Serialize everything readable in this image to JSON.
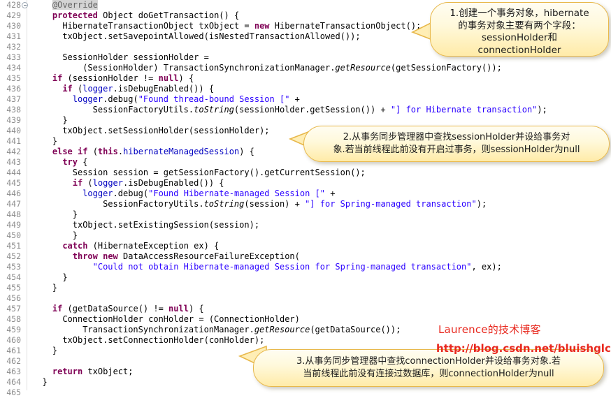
{
  "editor": {
    "first_line_number": 428,
    "fold_marker_line": 428,
    "lines": [
      {
        "n": "428",
        "fold": true,
        "indent": 4,
        "tokens": [
          {
            "t": "@Override",
            "c": "ann hl"
          }
        ]
      },
      {
        "n": "429",
        "fold": false,
        "indent": 4,
        "tokens": [
          {
            "t": "protected",
            "c": "kw"
          },
          {
            "t": " Object doGetTransaction() {",
            "c": ""
          }
        ]
      },
      {
        "n": "430",
        "fold": false,
        "indent": 6,
        "tokens": [
          {
            "t": "HibernateTransactionObject txObject = ",
            "c": ""
          },
          {
            "t": "new",
            "c": "kw"
          },
          {
            "t": " HibernateTransactionObject();",
            "c": ""
          }
        ]
      },
      {
        "n": "431",
        "fold": false,
        "indent": 6,
        "tokens": [
          {
            "t": "txObject.setSavepointAllowed(isNestedTransactionAllowed());",
            "c": ""
          }
        ]
      },
      {
        "n": "432",
        "fold": false,
        "indent": 0,
        "tokens": [
          {
            "t": "",
            "c": ""
          }
        ]
      },
      {
        "n": "433",
        "fold": false,
        "indent": 6,
        "tokens": [
          {
            "t": "SessionHolder sessionHolder =",
            "c": ""
          }
        ]
      },
      {
        "n": "434",
        "fold": false,
        "indent": 10,
        "tokens": [
          {
            "t": "(SessionHolder) TransactionSynchronizationManager.",
            "c": ""
          },
          {
            "t": "getResource",
            "c": "mth"
          },
          {
            "t": "(getSessionFactory());",
            "c": ""
          }
        ]
      },
      {
        "n": "435",
        "fold": false,
        "indent": 4,
        "tokens": [
          {
            "t": "if",
            "c": "kw"
          },
          {
            "t": " (sessionHolder != ",
            "c": ""
          },
          {
            "t": "null",
            "c": "kw"
          },
          {
            "t": ") {",
            "c": ""
          }
        ]
      },
      {
        "n": "436",
        "fold": false,
        "indent": 6,
        "tokens": [
          {
            "t": "if",
            "c": "kw"
          },
          {
            "t": " (",
            "c": ""
          },
          {
            "t": "logger",
            "c": "fld"
          },
          {
            "t": ".isDebugEnabled()) {",
            "c": ""
          }
        ]
      },
      {
        "n": "437",
        "fold": false,
        "indent": 8,
        "tokens": [
          {
            "t": "logger",
            "c": "fld"
          },
          {
            "t": ".debug(",
            "c": ""
          },
          {
            "t": "\"Found thread-bound Session [\"",
            "c": "str"
          },
          {
            "t": " +",
            "c": ""
          }
        ]
      },
      {
        "n": "438",
        "fold": false,
        "indent": 12,
        "tokens": [
          {
            "t": "SessionFactoryUtils.",
            "c": ""
          },
          {
            "t": "toString",
            "c": "mth"
          },
          {
            "t": "(sessionHolder.getSession()) + ",
            "c": ""
          },
          {
            "t": "\"] for Hibernate transaction\"",
            "c": "str"
          },
          {
            "t": ");",
            "c": ""
          }
        ]
      },
      {
        "n": "439",
        "fold": false,
        "indent": 6,
        "tokens": [
          {
            "t": "}",
            "c": ""
          }
        ]
      },
      {
        "n": "440",
        "fold": false,
        "indent": 6,
        "tokens": [
          {
            "t": "txObject.setSessionHolder(sessionHolder);",
            "c": ""
          }
        ]
      },
      {
        "n": "441",
        "fold": false,
        "indent": 4,
        "tokens": [
          {
            "t": "}",
            "c": ""
          }
        ]
      },
      {
        "n": "442",
        "fold": false,
        "indent": 4,
        "tokens": [
          {
            "t": "else",
            "c": "kw"
          },
          {
            "t": " ",
            "c": ""
          },
          {
            "t": "if",
            "c": "kw"
          },
          {
            "t": " (",
            "c": ""
          },
          {
            "t": "this",
            "c": "kw"
          },
          {
            "t": ".",
            "c": ""
          },
          {
            "t": "hibernateManagedSession",
            "c": "fld"
          },
          {
            "t": ") {",
            "c": ""
          }
        ]
      },
      {
        "n": "443",
        "fold": false,
        "indent": 6,
        "tokens": [
          {
            "t": "try",
            "c": "kw"
          },
          {
            "t": " {",
            "c": ""
          }
        ]
      },
      {
        "n": "444",
        "fold": false,
        "indent": 8,
        "tokens": [
          {
            "t": "Session session = getSessionFactory().getCurrentSession();",
            "c": ""
          }
        ]
      },
      {
        "n": "445",
        "fold": false,
        "indent": 8,
        "tokens": [
          {
            "t": "if",
            "c": "kw"
          },
          {
            "t": " (",
            "c": ""
          },
          {
            "t": "logger",
            "c": "fld"
          },
          {
            "t": ".isDebugEnabled()) {",
            "c": ""
          }
        ]
      },
      {
        "n": "446",
        "fold": false,
        "indent": 10,
        "tokens": [
          {
            "t": "logger",
            "c": "fld"
          },
          {
            "t": ".debug(",
            "c": ""
          },
          {
            "t": "\"Found Hibernate-managed Session [\"",
            "c": "str"
          },
          {
            "t": " +",
            "c": ""
          }
        ]
      },
      {
        "n": "447",
        "fold": false,
        "indent": 14,
        "tokens": [
          {
            "t": "SessionFactoryUtils.",
            "c": ""
          },
          {
            "t": "toString",
            "c": "mth"
          },
          {
            "t": "(session) + ",
            "c": ""
          },
          {
            "t": "\"] for Spring-managed transaction\"",
            "c": "str"
          },
          {
            "t": ");",
            "c": ""
          }
        ]
      },
      {
        "n": "448",
        "fold": false,
        "indent": 8,
        "tokens": [
          {
            "t": "}",
            "c": ""
          }
        ]
      },
      {
        "n": "449",
        "fold": false,
        "indent": 8,
        "tokens": [
          {
            "t": "txObject.setExistingSession(session);",
            "c": ""
          }
        ]
      },
      {
        "n": "450",
        "fold": false,
        "indent": 8,
        "tokens": [
          {
            "t": "}",
            "c": ""
          }
        ]
      },
      {
        "n": "451",
        "fold": false,
        "indent": 6,
        "tokens": [
          {
            "t": "catch",
            "c": "kw"
          },
          {
            "t": " (HibernateException ex) {",
            "c": ""
          }
        ]
      },
      {
        "n": "452",
        "fold": false,
        "indent": 8,
        "tokens": [
          {
            "t": "throw",
            "c": "kw"
          },
          {
            "t": " ",
            "c": ""
          },
          {
            "t": "new",
            "c": "kw"
          },
          {
            "t": " DataAccessResourceFailureException(",
            "c": ""
          }
        ]
      },
      {
        "n": "453",
        "fold": false,
        "indent": 12,
        "tokens": [
          {
            "t": "\"Could not obtain Hibernate-managed Session for Spring-managed transaction\"",
            "c": "str"
          },
          {
            "t": ", ex);",
            "c": ""
          }
        ]
      },
      {
        "n": "454",
        "fold": false,
        "indent": 6,
        "tokens": [
          {
            "t": "}",
            "c": ""
          }
        ]
      },
      {
        "n": "455",
        "fold": false,
        "indent": 4,
        "tokens": [
          {
            "t": "}",
            "c": ""
          }
        ]
      },
      {
        "n": "456",
        "fold": false,
        "indent": 0,
        "tokens": [
          {
            "t": "",
            "c": ""
          }
        ]
      },
      {
        "n": "457",
        "fold": false,
        "indent": 4,
        "tokens": [
          {
            "t": "if",
            "c": "kw"
          },
          {
            "t": " (getDataSource() != ",
            "c": ""
          },
          {
            "t": "null",
            "c": "kw"
          },
          {
            "t": ") {",
            "c": ""
          }
        ]
      },
      {
        "n": "458",
        "fold": false,
        "indent": 6,
        "tokens": [
          {
            "t": "ConnectionHolder conHolder = (ConnectionHolder)",
            "c": ""
          }
        ]
      },
      {
        "n": "459",
        "fold": false,
        "indent": 10,
        "tokens": [
          {
            "t": "TransactionSynchronizationManager.",
            "c": ""
          },
          {
            "t": "getResource",
            "c": "mth"
          },
          {
            "t": "(getDataSource());",
            "c": ""
          }
        ]
      },
      {
        "n": "460",
        "fold": false,
        "indent": 6,
        "tokens": [
          {
            "t": "txObject.setConnectionHolder(conHolder);",
            "c": ""
          }
        ]
      },
      {
        "n": "461",
        "fold": false,
        "indent": 4,
        "tokens": [
          {
            "t": "}",
            "c": ""
          }
        ]
      },
      {
        "n": "462",
        "fold": false,
        "indent": 0,
        "tokens": [
          {
            "t": "",
            "c": ""
          }
        ]
      },
      {
        "n": "463",
        "fold": false,
        "indent": 4,
        "tokens": [
          {
            "t": "return",
            "c": "kw"
          },
          {
            "t": " txObject;",
            "c": ""
          }
        ]
      },
      {
        "n": "464",
        "fold": false,
        "indent": 2,
        "tokens": [
          {
            "t": "}",
            "c": ""
          }
        ]
      },
      {
        "n": "465",
        "fold": false,
        "indent": 0,
        "tokens": [
          {
            "t": "",
            "c": ""
          }
        ]
      }
    ]
  },
  "annotations": [
    {
      "id": "callout-1",
      "text": "1.创建一个事务对象，hibernate\n的事务对象主要有两个字段：\nsessionHolder和\nconnectionHolder"
    },
    {
      "id": "callout-2",
      "text": "2.从事务同步管理器中查找sessionHolder并设给事务对\n象.若当前线程此前没有开启过事务，则sessionHolder为null"
    },
    {
      "id": "callout-3",
      "text": "3.从事务同步管理器中查找connectionHolder并设给事务对象.若\n当前线程此前没有连接过数据库，则connectionHolder为null"
    }
  ],
  "watermark": {
    "title": "Laurence的技术博客",
    "url": "http://blog.csdn.net/bluishglc",
    "color": "#e8281e"
  },
  "theme": {
    "background": "#ffffff",
    "line_number_color": "#8c8c8c",
    "keyword_color": "#7f0055",
    "string_color": "#2a00ff",
    "field_color": "#0000c0",
    "annotation_color": "#646464",
    "callout_fill": "#fff9dc",
    "callout_border": "#e8b84b"
  }
}
